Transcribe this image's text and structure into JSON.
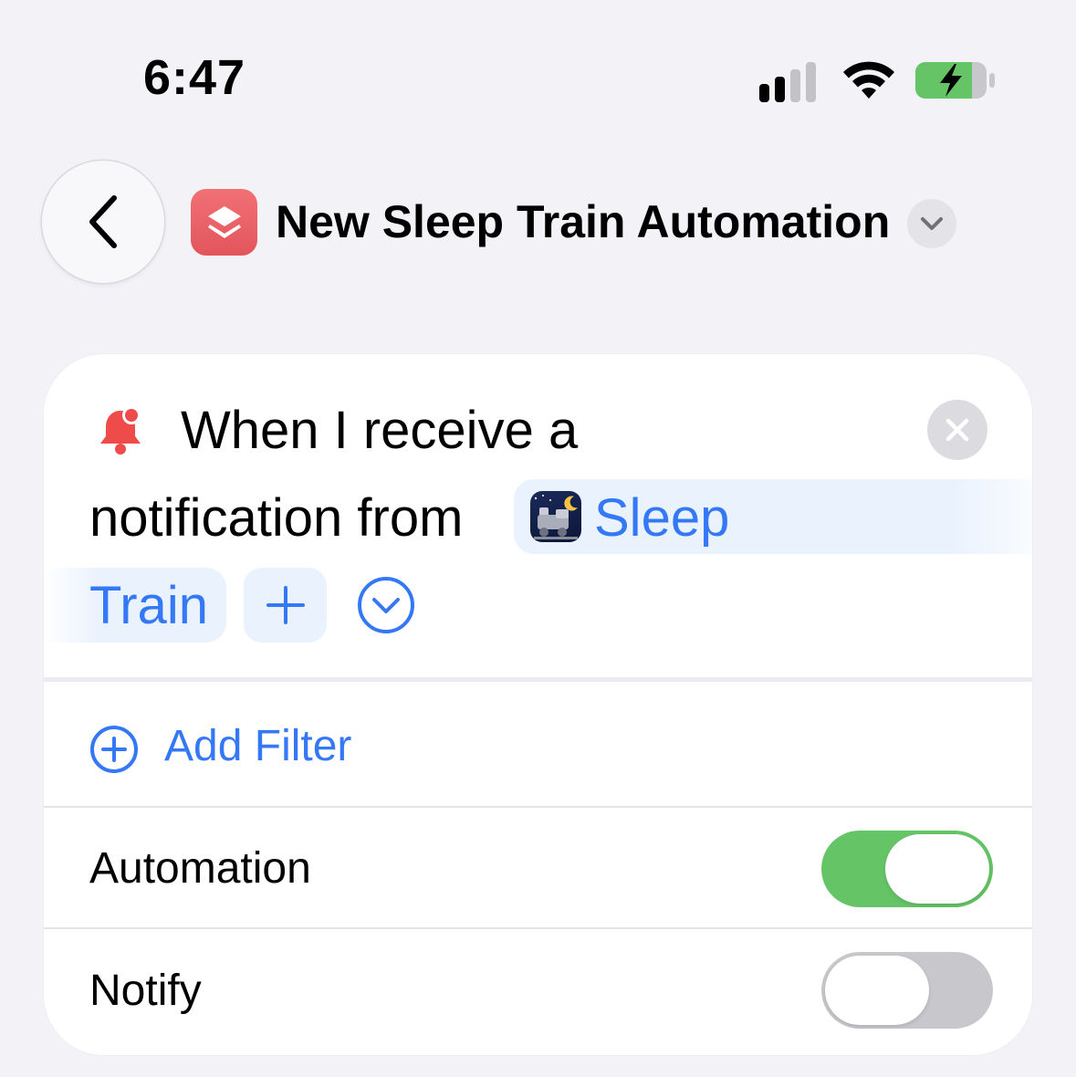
{
  "status_bar": {
    "time": "6:47",
    "signal_bars_active": 2,
    "signal_bars_total": 4,
    "battery_charging": true,
    "battery_color": "#65c466"
  },
  "nav": {
    "back_icon": "chevron-left-icon",
    "app_icon": "layers-icon",
    "app_icon_color": "#e85d62",
    "title": "New Sleep Train Automation",
    "title_menu_icon": "chevron-down-icon"
  },
  "trigger": {
    "icon": "bell-badge-icon",
    "line1": "When I receive a",
    "line2": "notification from",
    "app_name_part1": "Sleep",
    "app_name_part2": "Train",
    "app_icon": "train-icon",
    "add_icon": "plus-icon",
    "expand_icon": "chevron-down-circle-icon",
    "clear_icon": "close-icon"
  },
  "filters": {
    "add_filter_label": "Add Filter",
    "add_filter_icon": "plus-circle-icon"
  },
  "settings": {
    "automation_label": "Automation",
    "automation_enabled": true,
    "notify_label": "Notify",
    "notify_enabled": false
  },
  "colors": {
    "accent": "#3478f6",
    "toggle_on": "#65c466",
    "toggle_off": "#c8c8cc",
    "background": "#f2f2f7",
    "bell": "#ef4b4b"
  }
}
